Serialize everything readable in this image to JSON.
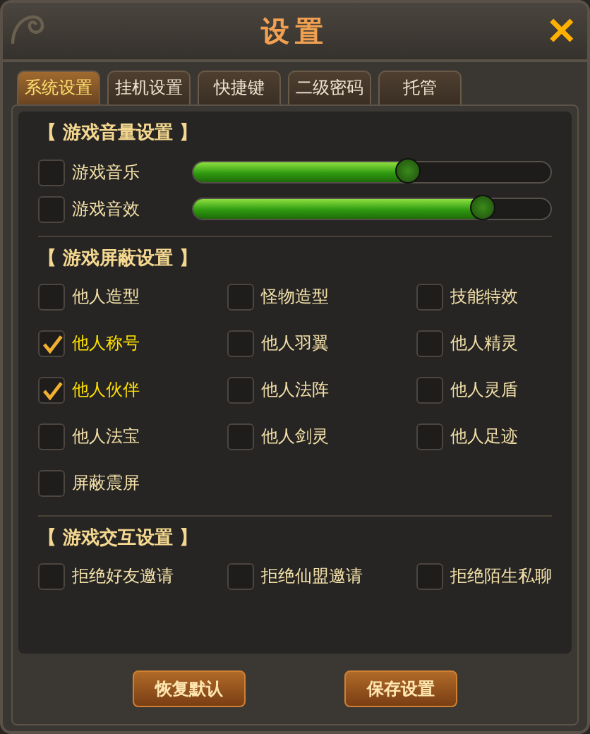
{
  "window": {
    "title": "设置",
    "close_label": "✕"
  },
  "tabs": [
    {
      "label": "系统设置",
      "selected": true
    },
    {
      "label": "挂机设置",
      "selected": false
    },
    {
      "label": "快捷键",
      "selected": false
    },
    {
      "label": "二级密码",
      "selected": false
    },
    {
      "label": "托管",
      "selected": false
    }
  ],
  "sections": [
    {
      "title": "【 游戏音量设置 】",
      "kind": "sliders",
      "items": [
        {
          "label": "游戏音乐",
          "checked": false,
          "level": 0.6
        },
        {
          "label": "游戏音效",
          "checked": false,
          "level": 0.81
        }
      ]
    },
    {
      "title": "【 游戏屏蔽设置 】",
      "kind": "checks",
      "items": [
        {
          "label": "他人造型",
          "checked": false
        },
        {
          "label": "怪物造型",
          "checked": false
        },
        {
          "label": "技能特效",
          "checked": false
        },
        {
          "label": "他人称号",
          "checked": true
        },
        {
          "label": "他人羽翼",
          "checked": false
        },
        {
          "label": "他人精灵",
          "checked": false
        },
        {
          "label": "他人伙伴",
          "checked": true
        },
        {
          "label": "他人法阵",
          "checked": false
        },
        {
          "label": "他人灵盾",
          "checked": false
        },
        {
          "label": "他人法宝",
          "checked": false
        },
        {
          "label": "他人剑灵",
          "checked": false
        },
        {
          "label": "他人足迹",
          "checked": false
        },
        {
          "label": "屏蔽震屏",
          "checked": false
        }
      ]
    },
    {
      "title": "【 游戏交互设置 】",
      "kind": "checks",
      "items": [
        {
          "label": "拒绝好友邀请",
          "checked": false
        },
        {
          "label": "拒绝仙盟邀请",
          "checked": false
        },
        {
          "label": "拒绝陌生私聊",
          "checked": false
        }
      ]
    }
  ],
  "buttons": [
    "恢复默认",
    "保存设置"
  ]
}
